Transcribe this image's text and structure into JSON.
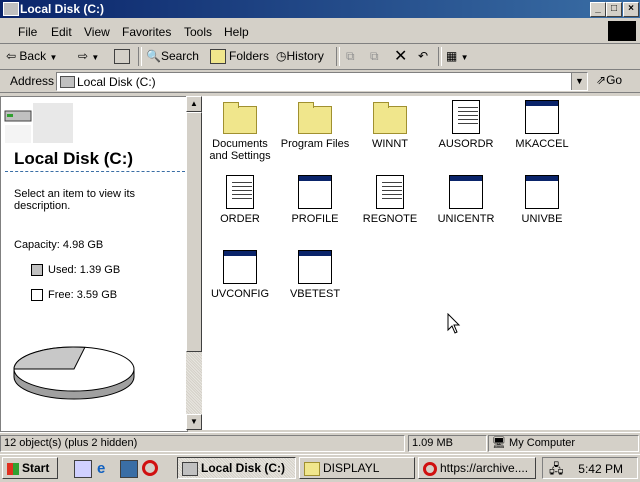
{
  "window": {
    "title": "Local Disk (C:)"
  },
  "menu": [
    "File",
    "Edit",
    "View",
    "Favorites",
    "Tools",
    "Help"
  ],
  "toolbar": {
    "back": "Back",
    "search": "Search",
    "folders": "Folders",
    "history": "History"
  },
  "address": {
    "label": "Address",
    "value": "Local Disk (C:)",
    "go": "Go"
  },
  "left_pane": {
    "title": "Local Disk (C:)",
    "hint": "Select an item to view its description.",
    "capacity": "Capacity: 4.98 GB",
    "used": "Used: 1.39 GB",
    "free": "Free: 3.59 GB",
    "used_fraction": 0.279
  },
  "files": [
    {
      "name": "Documents and Settings",
      "kind": "folder"
    },
    {
      "name": "Program Files",
      "kind": "folder"
    },
    {
      "name": "WINNT",
      "kind": "folder"
    },
    {
      "name": "AUSORDR",
      "kind": "doc"
    },
    {
      "name": "MKACCEL",
      "kind": "app"
    },
    {
      "name": "ORDER",
      "kind": "doc"
    },
    {
      "name": "PROFILE",
      "kind": "app"
    },
    {
      "name": "REGNOTE",
      "kind": "doc"
    },
    {
      "name": "UNICENTR",
      "kind": "app"
    },
    {
      "name": "UNIVBE",
      "kind": "app"
    },
    {
      "name": "UVCONFIG",
      "kind": "app"
    },
    {
      "name": "VBETEST",
      "kind": "app"
    }
  ],
  "status": {
    "objects": "12 object(s) (plus 2 hidden)",
    "size": "1.09 MB",
    "zone": "My Computer"
  },
  "taskbar": {
    "start": "Start",
    "tasks": [
      "Local Disk (C:)",
      "DISPLAYL",
      "https://archive...."
    ],
    "clock": "5:42 PM"
  },
  "colors": {
    "titlebar": "#0a246a",
    "face": "#d4d0c8",
    "folder": "#f0e68c"
  }
}
